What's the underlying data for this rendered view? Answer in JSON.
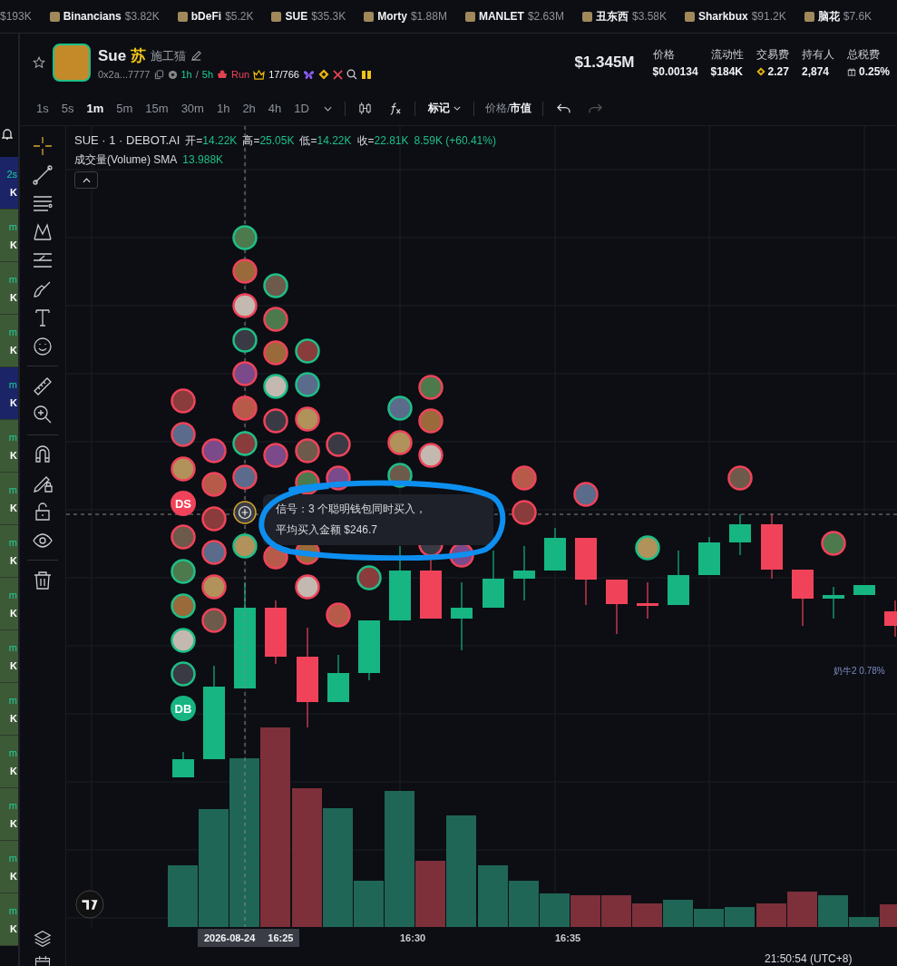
{
  "ticker": [
    {
      "price": "$193K"
    },
    {
      "name": "Binancians",
      "price": "$3.82K"
    },
    {
      "name": "bDeFi",
      "price": "$5.2K"
    },
    {
      "name": "SUE",
      "price": "$35.3K"
    },
    {
      "name": "Morty",
      "price": "$1.88M"
    },
    {
      "name": "MANLET",
      "price": "$2.63M"
    },
    {
      "name": "丑东西",
      "price": "$3.58K"
    },
    {
      "name": "Sharkbux",
      "price": "$91.2K"
    },
    {
      "name": "脑花",
      "price": "$7.6K"
    }
  ],
  "side_list": [
    {
      "age": "2s",
      "value": "K",
      "highlighted": true
    },
    {
      "age": "m",
      "value": "K",
      "highlighted": false
    },
    {
      "age": "m",
      "value": "K",
      "highlighted": false
    },
    {
      "age": "m",
      "value": "K",
      "highlighted": false
    },
    {
      "age": "m",
      "value": "K",
      "highlighted": true
    },
    {
      "age": "m",
      "value": "K",
      "highlighted": false
    },
    {
      "age": "m",
      "value": "K",
      "highlighted": false
    },
    {
      "age": "m",
      "value": "K",
      "highlighted": false
    },
    {
      "age": "m",
      "value": "K",
      "highlighted": false
    },
    {
      "age": "m",
      "value": "K",
      "highlighted": false
    },
    {
      "age": "m",
      "value": "K",
      "highlighted": false
    },
    {
      "age": "m",
      "value": "K",
      "highlighted": false
    },
    {
      "age": "m",
      "value": "K",
      "highlighted": false
    },
    {
      "age": "m",
      "value": "K",
      "highlighted": false
    },
    {
      "age": "m",
      "value": "K",
      "highlighted": false
    }
  ],
  "token": {
    "symbol": "Sue",
    "badge": "苏",
    "name": "施工猫",
    "address": "0x2a...7777",
    "age_1": "1h",
    "age_sep": "/",
    "age_2": "5h",
    "tag": "Run",
    "rank": "17/766"
  },
  "market_cap": "$1.345M",
  "stats": [
    {
      "label": "价格",
      "value": "$0.00134",
      "kind": "plain"
    },
    {
      "label": "流动性",
      "value": "$184K",
      "kind": "plain"
    },
    {
      "label": "交易费",
      "value": "2.27",
      "kind": "coin"
    },
    {
      "label": "持有人",
      "value": "2,874",
      "kind": "plain"
    },
    {
      "label": "总税费",
      "value": "0.25%",
      "kind": "gift"
    }
  ],
  "toolbar": {
    "intervals": [
      {
        "label": "1s",
        "selected": false
      },
      {
        "label": "5s",
        "selected": false
      },
      {
        "label": "1m",
        "selected": true
      },
      {
        "label": "5m",
        "selected": false
      },
      {
        "label": "15m",
        "selected": false
      },
      {
        "label": "30m",
        "selected": false
      },
      {
        "label": "1h",
        "selected": false
      },
      {
        "label": "2h",
        "selected": false
      },
      {
        "label": "4h",
        "selected": false
      },
      {
        "label": "1D",
        "selected": false
      }
    ],
    "marks": "标记",
    "price_label": "价格",
    "separator": "/",
    "mcap_label": "市值"
  },
  "legend": {
    "title": "SUE · 1 · DEBOT.AI",
    "ohlc": [
      {
        "label": "开=",
        "value": "14.22K"
      },
      {
        "label": "高=",
        "value": "25.05K"
      },
      {
        "label": "低=",
        "value": "14.22K"
      },
      {
        "label": "收=",
        "value": "22.81K"
      }
    ],
    "change": "8.59K (+60.41%)",
    "volume_label": "成交量(Volume) SMA",
    "volume_value": "13.988K"
  },
  "tool_groups": [
    [
      {
        "kind": "crosshair",
        "selected": true
      },
      {
        "kind": "line",
        "selected": false
      },
      {
        "kind": "hlines",
        "selected": false
      },
      {
        "kind": "pattern",
        "selected": false
      },
      {
        "kind": "fib",
        "selected": false
      },
      {
        "kind": "brush",
        "selected": false
      },
      {
        "kind": "text",
        "selected": false
      },
      {
        "kind": "emoji",
        "selected": false
      }
    ],
    [
      {
        "kind": "ruler",
        "selected": false
      },
      {
        "kind": "zoom",
        "selected": false
      }
    ],
    [
      {
        "kind": "magnet",
        "selected": false
      },
      {
        "kind": "pencil-lock",
        "selected": false
      },
      {
        "kind": "lock",
        "selected": false
      },
      {
        "kind": "eye",
        "selected": false
      }
    ],
    [
      {
        "kind": "trash",
        "selected": false
      }
    ]
  ],
  "chart": {
    "markers": [
      {
        "label": "DS",
        "color": "#f0435a"
      },
      {
        "label": "DB",
        "color": "#16b582"
      }
    ],
    "tooltip": [
      "信号：3 个聪明钱包同时买入，",
      "平均买入金额 $246.7"
    ],
    "price_line_label": "奶牛2 0.78%",
    "crosshair_date": "2026-08-24",
    "crosshair_time": "16:25",
    "x_labels": [
      "16:30",
      "16:35"
    ],
    "clock": "21:50:54 (UTC+8)"
  }
}
